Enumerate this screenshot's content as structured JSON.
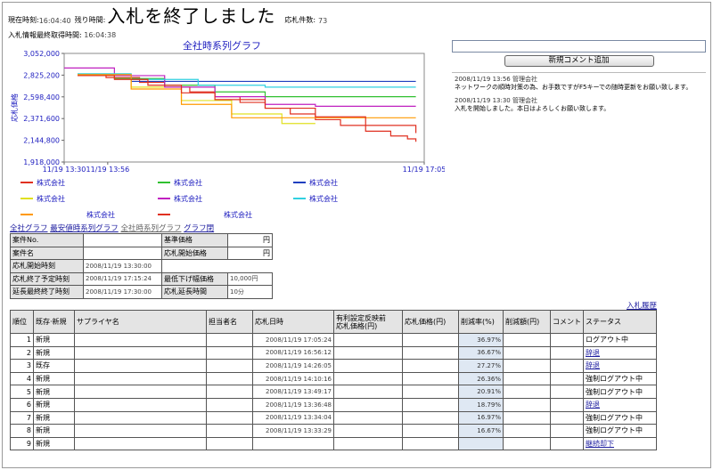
{
  "header": {
    "current_time_label": "現在時刻:",
    "current_time": "16:04:40",
    "remaining_label": "残り時間:",
    "title": "入札を終了しました",
    "bid_count_label": "応札件数:",
    "bid_count": "73",
    "last_fetch_label": "入札情報最終取得時間:",
    "last_fetch": "16:04:38"
  },
  "comment_panel": {
    "input_value": "",
    "add_button": "新規コメント追加",
    "comments": [
      {
        "meta": "2008/11/19 13:56 管理会社",
        "text": "ネットワークの順時対策の為、お手数ですがF5キーでの随時更新をお願い致します。"
      },
      {
        "meta": "2008/11/19 13:30 管理会社",
        "text": "入札を開始しました。本日はよろしくお願い致します。"
      }
    ]
  },
  "tabs": [
    "全社グラフ",
    "最安値時系列グラフ",
    "全社時系列グラフ",
    "グラフ閉"
  ],
  "info_table": {
    "rows": [
      [
        "案件No.",
        "",
        "基準価格",
        "円"
      ],
      [
        "案件名",
        "",
        "応札開始価格",
        "円"
      ],
      [
        "応札開始時刻",
        "2008/11/19 13:30:00",
        "",
        ""
      ],
      [
        "応札終了予定時刻",
        "2008/11/19 17:15:24",
        "最低下げ幅価格",
        "10,000円"
      ],
      [
        "延長最終終了時刻",
        "2008/11/19 17:30:00",
        "応札延長時間",
        "10分"
      ]
    ]
  },
  "history_link": "入札履歴",
  "bids_table": {
    "headers": [
      "順位",
      "既存·新規",
      "サプライヤ名",
      "担当者名",
      "応札日時",
      "有利設定反映前\n応札価格(円)",
      "応札価格(円)",
      "削減率(%)",
      "削減額(円)",
      "コメント",
      "ステータス"
    ],
    "rows": [
      {
        "rank": "1",
        "type": "新規",
        "supplier": "",
        "person": "",
        "datetime": "2008/11/19 17:05:24",
        "pre_price": "",
        "price": "",
        "rate": "36.97%",
        "amount": "",
        "comment": "",
        "status": "ログアウト中",
        "status_link": false
      },
      {
        "rank": "2",
        "type": "新規",
        "supplier": "",
        "person": "",
        "datetime": "2008/11/19 16:56:12",
        "pre_price": "",
        "price": "",
        "rate": "36.67%",
        "amount": "",
        "comment": "",
        "status": "辞退",
        "status_link": true
      },
      {
        "rank": "3",
        "type": "既存",
        "supplier": "",
        "person": "",
        "datetime": "2008/11/19 14:26:05",
        "pre_price": "",
        "price": "",
        "rate": "27.27%",
        "amount": "",
        "comment": "",
        "status": "辞退",
        "status_link": true
      },
      {
        "rank": "4",
        "type": "新規",
        "supplier": "",
        "person": "",
        "datetime": "2008/11/19 14:10:16",
        "pre_price": "",
        "price": "",
        "rate": "26.36%",
        "amount": "",
        "comment": "",
        "status": "強制ログアウト中",
        "status_link": false
      },
      {
        "rank": "5",
        "type": "新規",
        "supplier": "",
        "person": "",
        "datetime": "2008/11/19 13:49:17",
        "pre_price": "",
        "price": "",
        "rate": "20.91%",
        "amount": "",
        "comment": "",
        "status": "強制ログアウト中",
        "status_link": false
      },
      {
        "rank": "6",
        "type": "新規",
        "supplier": "",
        "person": "",
        "datetime": "2008/11/19 13:36:48",
        "pre_price": "",
        "price": "",
        "rate": "18.79%",
        "amount": "",
        "comment": "",
        "status": "辞退",
        "status_link": true
      },
      {
        "rank": "7",
        "type": "新規",
        "supplier": "",
        "person": "",
        "datetime": "2008/11/19 13:34:04",
        "pre_price": "",
        "price": "",
        "rate": "16.97%",
        "amount": "",
        "comment": "",
        "status": "強制ログアウト中",
        "status_link": false
      },
      {
        "rank": "8",
        "type": "新規",
        "supplier": "",
        "person": "",
        "datetime": "2008/11/19 13:33:29",
        "pre_price": "",
        "price": "",
        "rate": "16.67%",
        "amount": "",
        "comment": "",
        "status": "強制ログアウト中",
        "status_link": false
      },
      {
        "rank": "9",
        "type": "新規",
        "supplier": "",
        "person": "",
        "datetime": "",
        "pre_price": "",
        "price": "",
        "rate": "",
        "amount": "",
        "comment": "",
        "status": "継続却下",
        "status_link": true
      }
    ]
  },
  "chart_data": {
    "type": "line",
    "title": "全社時系列グラフ",
    "ylabel": "応札価格",
    "xlabel": "",
    "ylim": [
      1918000,
      3052000
    ],
    "y_ticks": [
      "3,052,000",
      "2,825,200",
      "2,598,400",
      "2,371,600",
      "2,144,800",
      "1,918,000"
    ],
    "x_ticks": [
      "11/19 13:30",
      "11/19 13:56",
      "11/19 17:05"
    ],
    "x_tick_minutes": [
      0,
      26,
      215
    ],
    "xlim_minutes": [
      0,
      215
    ],
    "legend_position": "bottom",
    "series": [
      {
        "name": "株式会社",
        "color": "#e03020",
        "x": [
          8,
          25,
          45,
          60,
          75,
          90,
          105,
          120,
          135,
          150,
          165,
          180,
          195,
          205,
          210
        ],
        "values": [
          2830000,
          2800000,
          2750000,
          2700000,
          2650000,
          2600000,
          2540000,
          2480000,
          2420000,
          2360000,
          2300000,
          2240000,
          2190000,
          2160000,
          2130000
        ]
      },
      {
        "name": "株式会社",
        "color": "#30c030",
        "x": [
          8,
          30,
          60,
          90,
          120,
          150,
          180,
          210
        ],
        "values": [
          2830000,
          2790000,
          2720000,
          2650000,
          2600000,
          2600000,
          2600000,
          2600000
        ]
      },
      {
        "name": "株式会社",
        "color": "#1f3fbf",
        "x": [
          8,
          40,
          70,
          100,
          130,
          160,
          190,
          210
        ],
        "values": [
          2830000,
          2760000,
          2760000,
          2760000,
          2760000,
          2760000,
          2760000,
          2760000
        ]
      },
      {
        "name": "株式会社",
        "color": "#e0e020",
        "x": [
          8,
          40,
          70,
          100,
          130,
          150
        ],
        "values": [
          2830000,
          2700000,
          2560000,
          2420000,
          2320000,
          2320000
        ]
      },
      {
        "name": "株式会社",
        "color": "#c020c0",
        "x": [
          0,
          30,
          60,
          90,
          120,
          150,
          180,
          210
        ],
        "values": [
          2900000,
          2820000,
          2700000,
          2600000,
          2520000,
          2500000,
          2500000,
          2500000
        ]
      },
      {
        "name": "株式会社",
        "color": "#30d0e0",
        "x": [
          8,
          40,
          80,
          120,
          160,
          210
        ],
        "values": [
          2840000,
          2780000,
          2720000,
          2700000,
          2700000,
          2700000
        ]
      },
      {
        "name": "株式会社",
        "color": "#ff9900",
        "x": [
          8,
          40,
          70,
          100,
          120,
          140,
          160,
          210
        ],
        "values": [
          2830000,
          2680000,
          2520000,
          2380000,
          2380000,
          2380000,
          2380000,
          2380000
        ]
      },
      {
        "name": "株式会社",
        "color": "#e03020",
        "x": [
          8,
          30,
          50,
          70,
          90,
          120,
          150,
          180,
          210
        ],
        "values": [
          2820000,
          2780000,
          2720000,
          2640000,
          2570000,
          2480000,
          2390000,
          2300000,
          2220000
        ]
      }
    ]
  }
}
